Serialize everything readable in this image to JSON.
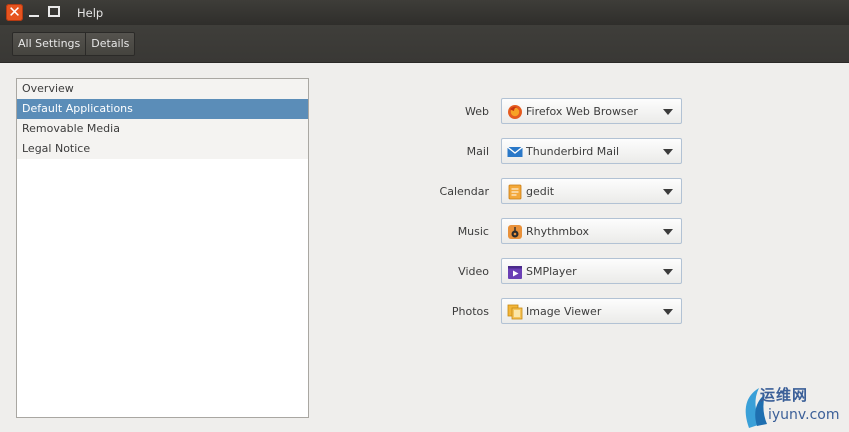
{
  "window": {
    "menu_help": "Help"
  },
  "toolbar": {
    "crumbs": [
      "All Settings",
      "Details"
    ]
  },
  "sidebar": {
    "items": [
      {
        "label": "Overview",
        "selected": false
      },
      {
        "label": "Default Applications",
        "selected": true
      },
      {
        "label": "Removable Media",
        "selected": false
      },
      {
        "label": "Legal Notice",
        "selected": false
      }
    ]
  },
  "defaults": [
    {
      "label": "Web",
      "app": "Firefox Web Browser",
      "icon": "firefox-icon"
    },
    {
      "label": "Mail",
      "app": "Thunderbird Mail",
      "icon": "mail-icon"
    },
    {
      "label": "Calendar",
      "app": "gedit",
      "icon": "gedit-icon"
    },
    {
      "label": "Music",
      "app": "Rhythmbox",
      "icon": "rhythmbox-icon"
    },
    {
      "label": "Video",
      "app": "SMPlayer",
      "icon": "smplayer-icon"
    },
    {
      "label": "Photos",
      "app": "Image Viewer",
      "icon": "image-viewer-icon"
    }
  ],
  "watermark": {
    "line1": "运维网",
    "line2": "iyunv.com"
  },
  "colors": {
    "selection": "#5b8db8",
    "close_button": "#e6541f",
    "titlebar": "#3c3b37"
  }
}
